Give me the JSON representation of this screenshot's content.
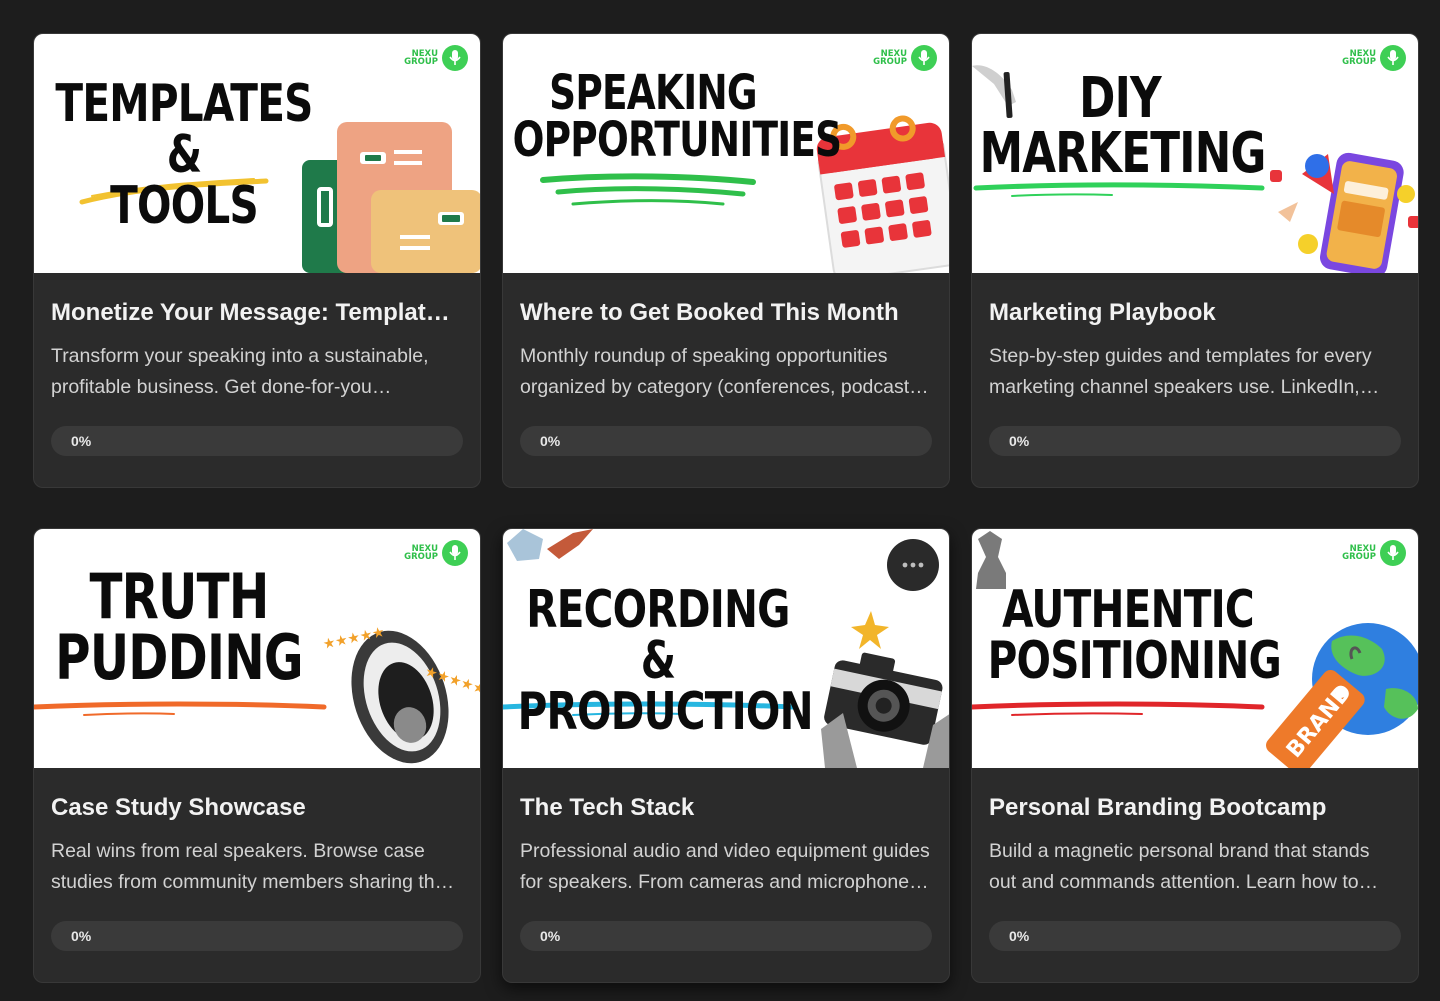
{
  "brand": {
    "line1": "NEXU",
    "line2": "GROUP",
    "icon": "microphone-icon",
    "color": "#3ecf55"
  },
  "cards": [
    {
      "banner_line1": "TEMPLATES &",
      "banner_line2": "TOOLS",
      "title": "Monetize Your Message: Templates & Tools",
      "description": "Transform your speaking into a sustainable, profitable business. Get done-for-you templates, tools and resources.",
      "progress": 0,
      "progress_label": "0%",
      "accent": "#f2c230"
    },
    {
      "banner_line1": "SPEAKING",
      "banner_line2": "OPPORTUNITIES",
      "title": "Where to Get Booked This Month",
      "description": "Monthly roundup of speaking opportunities organized by category (conferences, podcasts and more).",
      "progress": 0,
      "progress_label": "0%",
      "accent": "#2fbf4a"
    },
    {
      "banner_line1": "DIY",
      "banner_line2": "MARKETING",
      "title": "Marketing Playbook",
      "description": "Step-by-step guides and templates for every marketing channel speakers use. LinkedIn, email and more.",
      "progress": 0,
      "progress_label": "0%",
      "accent": "#2fd15a"
    },
    {
      "banner_line1": "TRUTH",
      "banner_line2": "PUDDING",
      "title": "Case Study Showcase",
      "description": "Real wins from real speakers. Browse case studies from community members sharing their results.",
      "progress": 0,
      "progress_label": "0%",
      "accent": "#f06a2a"
    },
    {
      "banner_line1": "RECORDING &",
      "banner_line2": "PRODUCTION",
      "title": "The Tech Stack",
      "description": "Professional audio and video equipment guides for speakers. From cameras and microphones to lighting.",
      "progress": 0,
      "progress_label": "0%",
      "accent": "#27b6e0",
      "more_icon": "more-horizontal-icon"
    },
    {
      "banner_line1": "AUTHENTIC",
      "banner_line2": "POSITIONING",
      "title": "Personal Branding Bootcamp",
      "description": "Build a magnetic personal brand that stands out and commands attention. Learn how to position yourself.",
      "progress": 0,
      "progress_label": "0%",
      "accent": "#e0262a",
      "tag_text": "BRAND"
    }
  ]
}
